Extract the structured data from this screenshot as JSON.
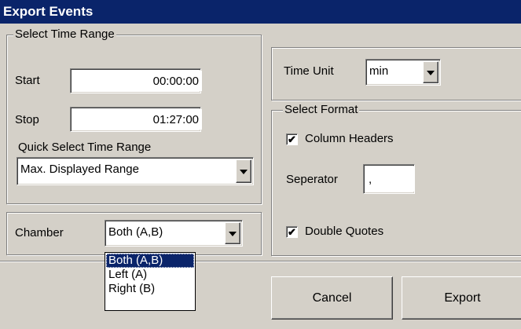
{
  "window": {
    "title": "Export Events"
  },
  "time_range": {
    "legend": "Select Time Range",
    "start_label": "Start",
    "start_value": "00:00:00",
    "stop_label": "Stop",
    "stop_value": "01:27:00",
    "quick_label": "Quick Select Time Range",
    "quick_value": "Max. Displayed Range"
  },
  "chamber": {
    "label": "Chamber",
    "value": "Both (A,B)",
    "options": [
      "Both (A,B)",
      "Left (A)",
      "Right (B)"
    ],
    "selected_index": 0
  },
  "time_unit": {
    "label": "Time Unit",
    "value": "min"
  },
  "format": {
    "legend": "Select Format",
    "column_headers_label": "Column Headers",
    "column_headers_checked": true,
    "separator_label": "Seperator",
    "separator_value": ",",
    "double_quotes_label": "Double Quotes",
    "double_quotes_checked": true
  },
  "buttons": {
    "cancel": "Cancel",
    "export": "Export"
  }
}
